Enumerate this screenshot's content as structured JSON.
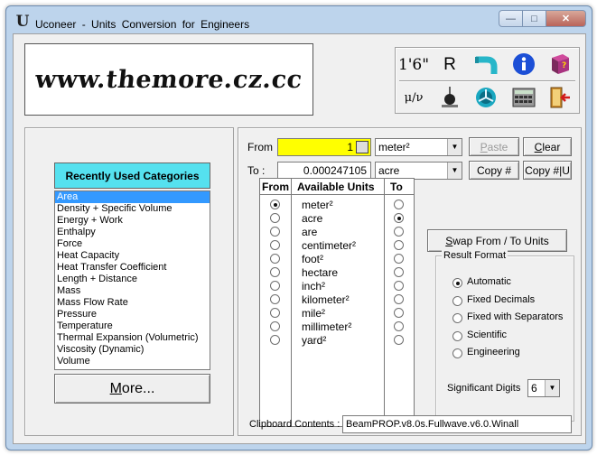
{
  "window": {
    "logo_glyph": "U",
    "title": "Uconeer  -  Units  Conversion  for  Engineers",
    "btn_min": "—",
    "btn_max": "□",
    "btn_close": "✕"
  },
  "banner": {
    "text": "www.themore.cz.cc"
  },
  "toolbox": {
    "feet_inches": "1'6\"",
    "r_label": "R",
    "mu_nu": "μ/ν"
  },
  "left": {
    "recent_title": "Recently Used Categories",
    "categories": [
      "Area",
      "Density + Specific Volume",
      "Energy + Work",
      "Enthalpy",
      "Force",
      "Heat Capacity",
      "Heat Transfer Coefficient",
      "Length + Distance",
      "Mass",
      "Mass Flow Rate",
      "Pressure",
      "Temperature",
      "Thermal Expansion (Volumetric)",
      "Viscosity (Dynamic)",
      "Volume"
    ],
    "selected_index": 0,
    "more_button": "More..."
  },
  "conversion": {
    "from_label": "From",
    "to_label": "To :",
    "from_value": "1",
    "to_value": "0.000247105",
    "from_unit": "meter²",
    "to_unit": "acre",
    "paste_button": "Paste",
    "clear_button": "Clear",
    "copy_hash_button": "Copy #",
    "copy_hash_u_button": "Copy #|U"
  },
  "units": {
    "col_from": "From",
    "col_available": "Available Units",
    "col_to": "To",
    "list": [
      "meter²",
      "acre",
      "are",
      "centimeter²",
      "foot²",
      "hectare",
      "inch²",
      "kilometer²",
      "mile²",
      "millimeter²",
      "yard²"
    ],
    "from_selected": 0,
    "to_selected": 1
  },
  "swap_button": "Swap From / To Units",
  "result_format": {
    "title": "Result Format",
    "options": [
      "Automatic",
      "Fixed Decimals",
      "Fixed with Separators",
      "Scientific",
      "Engineering"
    ],
    "selected": 0,
    "sig_digits_label": "Significant Digits",
    "sig_digits_value": "6"
  },
  "clipboard": {
    "label": "Clipboard Contents :",
    "value": "BeamPROP.v8.0s.Fullwave.v6.0.Winall"
  }
}
